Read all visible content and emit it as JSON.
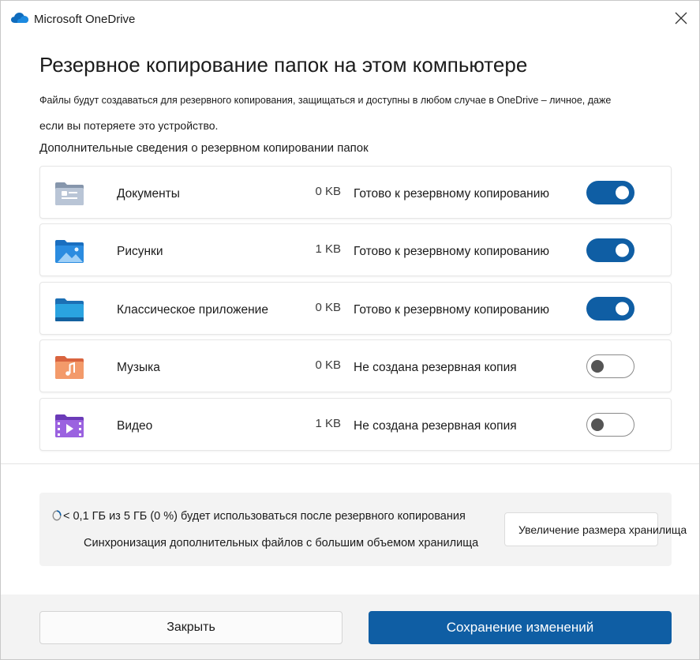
{
  "window": {
    "app_title": "Microsoft OneDrive",
    "logo_icon": "onedrive-cloud-icon",
    "close_icon": "close-icon",
    "accent_color": "#0f5ea4"
  },
  "main": {
    "heading": "Резервное копирование папок на этом компьютере",
    "description_line1": "Файлы будут создаваться для резервного копирования, защищаться и доступны в любом случае в OneDrive – личное, даже",
    "description_line2": "если вы потеряете это устройство.",
    "more_info_link": "Дополнительные сведения о резервном копировании папок"
  },
  "folders": [
    {
      "name": "Документы",
      "size": "0 KB",
      "status": "Готово к резервному копированию",
      "enabled": true,
      "icon": "documents-folder-icon"
    },
    {
      "name": "Рисунки",
      "size": "1 KB",
      "status": "Готово к резервному копированию",
      "enabled": true,
      "icon": "pictures-folder-icon"
    },
    {
      "name": "Классическое приложение",
      "size": "0 KB",
      "status": "Готово к резервному копированию",
      "enabled": true,
      "icon": "desktop-folder-icon"
    },
    {
      "name": "Музыка",
      "size": "0 KB",
      "status": "Не создана резервная копия",
      "enabled": false,
      "icon": "music-folder-icon"
    },
    {
      "name": "Видео",
      "size": "1 KB",
      "status": "Не создана резервная копия",
      "enabled": false,
      "icon": "videos-folder-icon"
    }
  ],
  "storage": {
    "usage_text": "< 0,1 ГБ из 5 ГБ (0 %) будет использоваться после резервного копирования",
    "sync_text": "Синхронизация дополнительных файлов с большим объемом хранилища",
    "increase_button": "Увеличение размера хранилища"
  },
  "footer": {
    "close_label": "Закрыть",
    "save_label": "Сохранение изменений"
  }
}
